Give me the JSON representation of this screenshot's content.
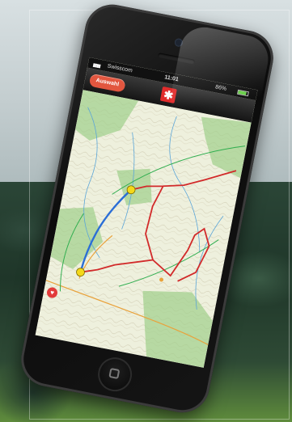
{
  "status_bar": {
    "carrier": "Swisscom",
    "time": "11:01",
    "battery": "86%",
    "battery_level": 0.86
  },
  "nav_bar": {
    "select_label": "Auswahl",
    "logo": "✱"
  },
  "colors": {
    "route": "#d22a2a",
    "track": "#2b6ed6",
    "marker": "#f4d81a",
    "accent": "#e2563f"
  }
}
